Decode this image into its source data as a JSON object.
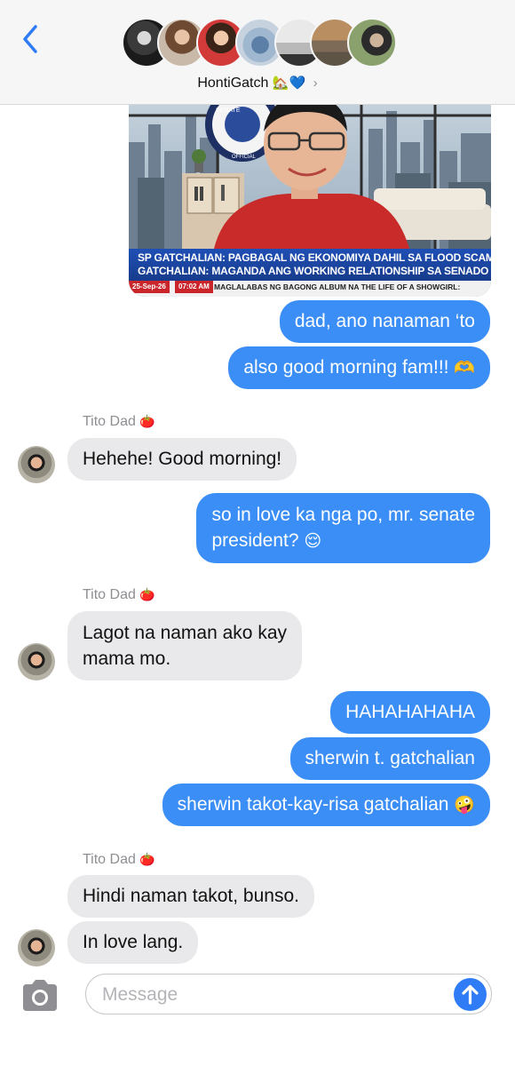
{
  "header": {
    "back_icon": "chevron-left-icon",
    "group_name": "HontiGatch",
    "group_emojis": "🏡💙",
    "chevron": "›"
  },
  "news_image": {
    "ticker_line1": "SP GATCHALIAN: PAGBAGAL NG EKONOMIYA DAHIL SA FLOOD SCAM",
    "ticker_line2": "GATCHALIAN: MAGANDA ANG WORKING RELATIONSHIP SA SENADO",
    "date": "25-Sep-26",
    "time": "07:02 AM",
    "crawl": "MAGLALABAS NG BAGONG ALBUM NA THE LIFE OF A SHOWGIRL:",
    "seal_text": "SENATE",
    "seal_text2": "OFFICIAL"
  },
  "messages": [
    {
      "id": "m1",
      "direction": "outgoing",
      "text": "dad, ano nanaman ‘to"
    },
    {
      "id": "m2",
      "direction": "outgoing",
      "text": "also good morning fam!!!",
      "emoji": "🫶"
    },
    {
      "id": "s1",
      "sender": "Tito Dad",
      "sender_emoji": "🍅"
    },
    {
      "id": "m3",
      "direction": "incoming",
      "text": "Hehehe! Good morning!"
    },
    {
      "id": "m4",
      "direction": "outgoing",
      "text_line1": "so in love ka nga po, mr. senate",
      "text_line2": "president?",
      "emoji": "😌"
    },
    {
      "id": "s2",
      "sender": "Tito Dad",
      "sender_emoji": "🍅"
    },
    {
      "id": "m5",
      "direction": "incoming",
      "text_line1": "Lagot na naman ako kay",
      "text_line2": "mama mo."
    },
    {
      "id": "m6",
      "direction": "outgoing",
      "text": "HAHAHAHAHA"
    },
    {
      "id": "m7",
      "direction": "outgoing",
      "text": "sherwin t. gatchalian"
    },
    {
      "id": "m8",
      "direction": "outgoing",
      "text": "sherwin takot-kay-risa gatchalian",
      "emoji": "🤪"
    },
    {
      "id": "s3",
      "sender": "Tito Dad",
      "sender_emoji": "🍅"
    },
    {
      "id": "m9",
      "direction": "incoming",
      "text": "Hindi naman takot, bunso."
    },
    {
      "id": "m10",
      "direction": "incoming",
      "text": "In love lang."
    }
  ],
  "composer": {
    "placeholder": "Message",
    "camera_icon": "camera-icon",
    "send_icon": "arrow-up-icon"
  },
  "colors": {
    "outgoing_bubble": "#3a8ef6",
    "incoming_bubble": "#e9e9eb",
    "accent": "#2f7cf6"
  }
}
